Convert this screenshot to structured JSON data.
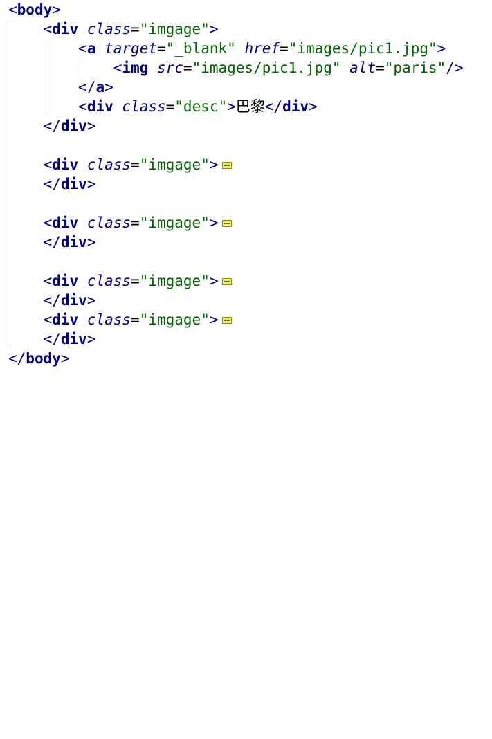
{
  "code": {
    "tag_body": "body",
    "tag_div": "div",
    "tag_a": "a",
    "tag_img": "img",
    "attr_class": "class",
    "attr_target": "target",
    "attr_href": "href",
    "attr_src": "src",
    "attr_alt": "alt",
    "val_imgage": "\"imgage\"",
    "val_blank": "\"_blank\"",
    "val_pic": "\"images/pic1.jpg\"",
    "val_paris": "\"paris\"",
    "val_desc": "\"desc\"",
    "text_paris": "巴黎"
  },
  "colors": {
    "tag": "#000080",
    "attribute_value": "#006400",
    "text": "#000000",
    "fold_marker": "#f1f177",
    "indent_guide": "#d0d0d0"
  },
  "icons": {
    "collapsed_block": "fold-marker-icon"
  }
}
